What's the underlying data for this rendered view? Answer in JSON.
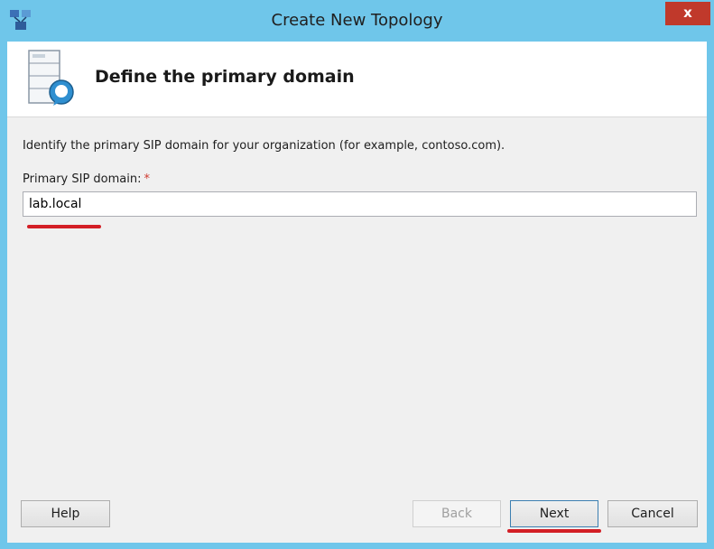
{
  "window": {
    "title": "Create New Topology",
    "close_label": "x",
    "accent_color": "#6fc6ea"
  },
  "header": {
    "step_title": "Define the primary domain",
    "icon": "server-with-speech-bubble-icon"
  },
  "body": {
    "instruction": "Identify the primary SIP domain for your organization (for example, contoso.com).",
    "field_label": "Primary SIP domain:",
    "required_marker": "*",
    "domain_value": "lab.local"
  },
  "buttons": {
    "help": "Help",
    "back": "Back",
    "next": "Next",
    "cancel": "Cancel"
  },
  "annotation_color": "#d31f26"
}
